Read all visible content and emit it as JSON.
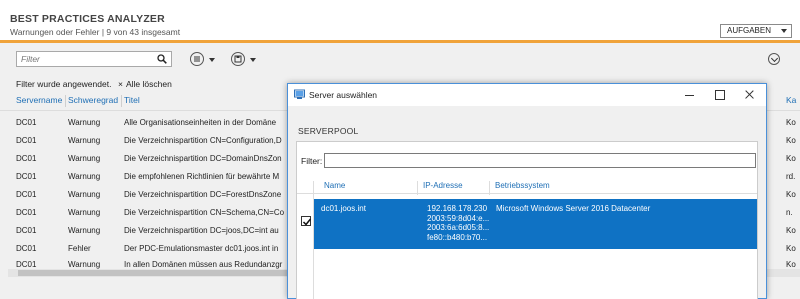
{
  "header": {
    "title": "BEST PRACTICES ANALYZER",
    "subtitle": "Warnungen oder Fehler | 9 von 43 insgesamt",
    "tasks_label": "AUFGABEN"
  },
  "toolbar": {
    "filter_placeholder": "Filter",
    "filter_applied": "Filter wurde angewendet.",
    "clear_all": "Alle löschen",
    "clear_icon": "×"
  },
  "columns": [
    "Servername",
    "Schweregrad",
    "Titel",
    "Ka"
  ],
  "rows": [
    {
      "server": "DC01",
      "severity": "Warnung",
      "title": "Alle Organisationseinheiten in der Domäne",
      "cat": "Ko"
    },
    {
      "server": "DC01",
      "severity": "Warnung",
      "title": "Die Verzeichnispartition CN=Configuration,D",
      "cat": "Ko"
    },
    {
      "server": "DC01",
      "severity": "Warnung",
      "title": "Die Verzeichnispartition DC=DomainDnsZon",
      "cat": "Ko"
    },
    {
      "server": "DC01",
      "severity": "Warnung",
      "title": "Die empfohlenen Richtlinien für bewährte M",
      "cat": "rd."
    },
    {
      "server": "DC01",
      "severity": "Warnung",
      "title": "Die Verzeichnispartition DC=ForestDnsZone",
      "cat": "Ko"
    },
    {
      "server": "DC01",
      "severity": "Warnung",
      "title": "Die Verzeichnispartition CN=Schema,CN=Co",
      "cat": "n."
    },
    {
      "server": "DC01",
      "severity": "Warnung",
      "title": "Die Verzeichnispartition DC=joos,DC=int au",
      "cat": "Ko"
    },
    {
      "server": "DC01",
      "severity": "Fehler",
      "title": "Der PDC-Emulationsmaster dc01.joos.int in",
      "cat": "Ko"
    },
    {
      "server": "DC01",
      "severity": "Warnung",
      "title": "In allen Domänen müssen aus Redundanzgr",
      "cat": "Ko"
    }
  ],
  "dialog": {
    "title": "Server auswählen",
    "section": "SERVERPOOL",
    "filter_label": "Filter:",
    "filter_value": "",
    "columns": [
      "Name",
      "IP-Adresse",
      "Betriebssystem"
    ],
    "servers": [
      {
        "name": "dc01.joos.int",
        "ips": [
          "192.168.178.230",
          "2003:59:8d04:e...",
          "2003:6a:6d05:8...",
          "fe80::b480:b70..."
        ],
        "os": "Microsoft Windows Server 2016 Datacenter",
        "checked": true
      }
    ]
  },
  "colors": {
    "accent_orange": "#f0a33a",
    "link_blue": "#1f6fb5",
    "selection_blue": "#0f72c4"
  }
}
